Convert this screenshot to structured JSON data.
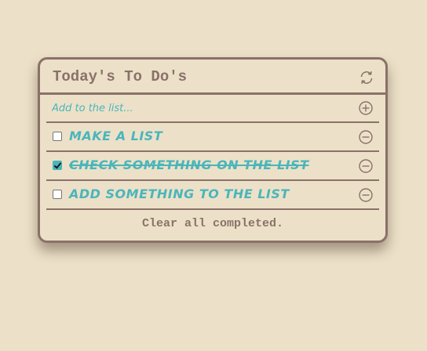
{
  "header": {
    "title": "Today's To Do's",
    "refresh_icon": "refresh-icon"
  },
  "add_item": {
    "placeholder": "Add to the list...",
    "add_icon": "plus-circle-icon"
  },
  "items": [
    {
      "text": "make a list",
      "completed": false,
      "remove_icon": "minus-circle-icon"
    },
    {
      "text": "check something on the list",
      "completed": true,
      "remove_icon": "minus-circle-icon"
    },
    {
      "text": "add something to the list",
      "completed": false,
      "remove_icon": "minus-circle-icon"
    }
  ],
  "footer": {
    "clear_label": "Clear all completed."
  },
  "colors": {
    "background": "#ece1c8",
    "border": "#8a7169",
    "accent": "#4bb5bb"
  }
}
